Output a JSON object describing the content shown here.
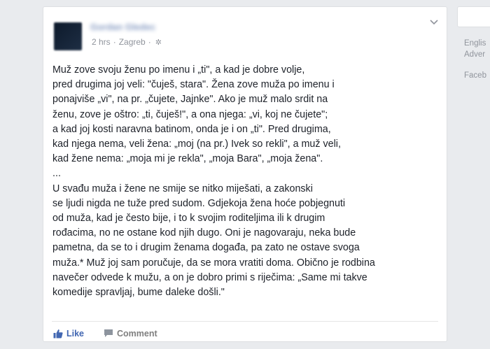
{
  "post": {
    "author_name": "Gordan Gledec",
    "time": "2 hrs",
    "separator": "·",
    "location": "Zagreb",
    "privacy_icon": "gear-icon",
    "menu_icon": "chevron-down-icon",
    "lines": [
      "Muž zove svoju ženu po imenu i „ti\", a kad je dobre volje,",
      "pred drugima joj veli: \"čuješ, stara\". Žena zove muža po imenu i",
      "ponajviše „vi\", na pr. „čujete, Jajnke\". Ako je muž malo srdit na",
      "ženu, zove je oštro: „ti, čuješ!\", a ona njega: „vi, koj ne čujete\";",
      "a kad joj kosti naravna batinom, onda je i on „ti\". Pred drugima,",
      "kad njega nema, veli žena: „moj (na pr.) Ivek so rekli\", a muž veli,",
      "kad žene nema: „moja mi je rekla\", „moja Bara\", „moja žena\".",
      "...",
      "U svađu muža i žene ne smije se nitko miješati, a zakonski",
      "se ljudi nigda ne tuže pred sudom. Gdjekoja žena hoće pobjegnuti",
      "od muža, kad je često bije, i to k svojim roditeljima ili k drugim",
      "rođacima, no ne ostane kod njih dugo. Oni je nagovaraju, neka bude",
      "pametna, da se to i drugim ženama događa, pa zato ne ostave svoga",
      "muža.* Muž joj sam poručuje, da se mora vratiti doma. Obično je rodbina",
      "navečer odvede k mužu, a on je dobro primi s riječima: „Same mi takve",
      "komedije spravljaj, bume daleke došli.\""
    ],
    "actions": {
      "like_label": "Like",
      "comment_label": "Comment"
    }
  },
  "sidebar": {
    "lines": [
      "Englis",
      "Adver"
    ],
    "footer": "Faceb"
  },
  "colors": {
    "link_blue": "#4267b2",
    "text": "#1d2129",
    "meta_gray": "#90949c",
    "page_bg": "#e9ebee"
  }
}
